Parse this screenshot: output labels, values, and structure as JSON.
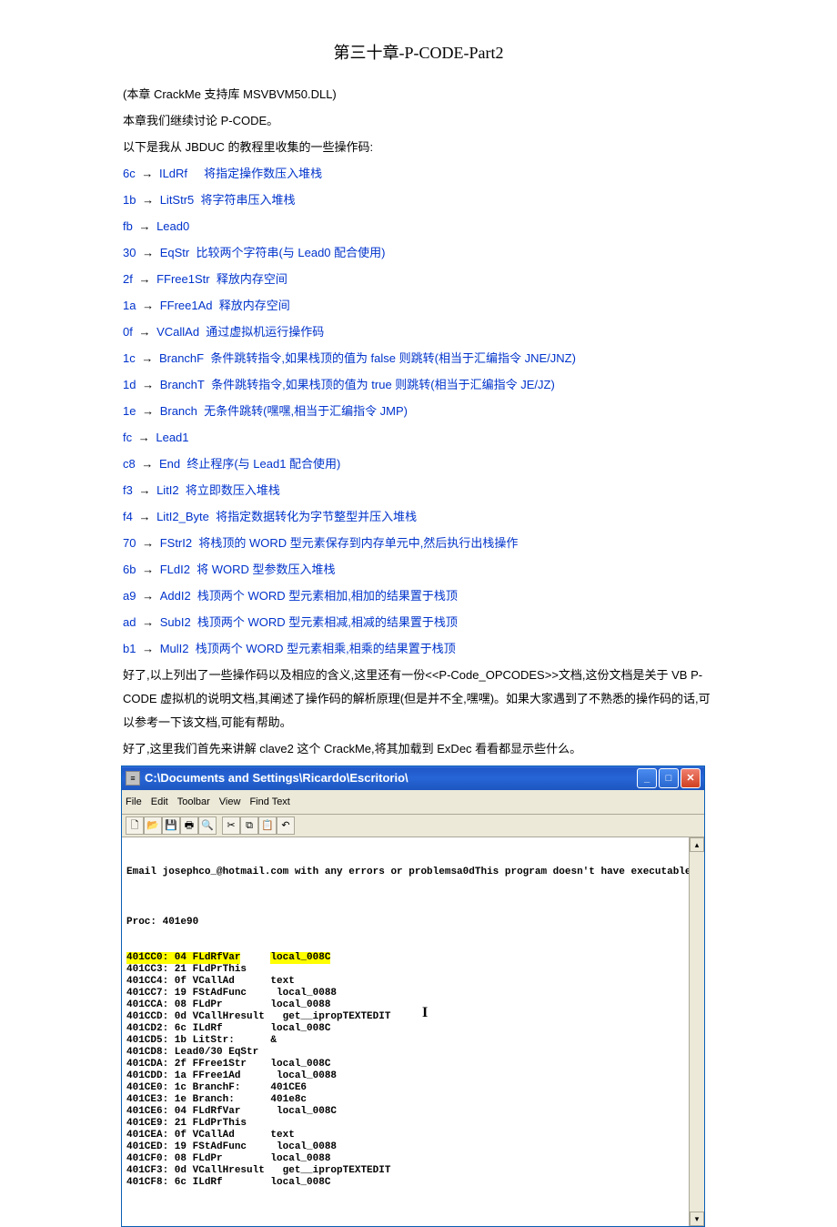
{
  "title": "第三十章-P-CODE-Part2",
  "intro1": "(本章 CrackMe 支持库 MSVBVM50.DLL)",
  "intro2": "本章我们继续讨论 P-CODE。",
  "intro3": "以下是我从 JBDUC 的教程里收集的一些操作码:",
  "opcodes": [
    {
      "hex": "6c",
      "name": "ILdRf",
      "desc": "将指定操作数压入堆栈",
      "spaced": true
    },
    {
      "hex": "1b",
      "name": "LitStr5",
      "desc": "将字符串压入堆栈"
    },
    {
      "hex": "fb",
      "name": "Lead0",
      "desc": ""
    },
    {
      "hex": "30",
      "name": "EqStr",
      "desc": "比较两个字符串(与 Lead0 配合使用)"
    },
    {
      "hex": "2f",
      "name": "FFree1Str",
      "desc": "释放内存空间"
    },
    {
      "hex": "1a",
      "name": "FFree1Ad",
      "desc": "释放内存空间"
    },
    {
      "hex": "0f",
      "name": "VCallAd",
      "desc": "通过虚拟机运行操作码"
    },
    {
      "hex": "1c",
      "name": "BranchF",
      "desc": "条件跳转指令,如果栈顶的值为 false 则跳转(相当于汇编指令 JNE/JNZ)"
    },
    {
      "hex": "1d",
      "name": "BranchT",
      "desc": "条件跳转指令,如果栈顶的值为 true 则跳转(相当于汇编指令 JE/JZ)"
    },
    {
      "hex": "1e",
      "name": "Branch",
      "desc": "无条件跳转(嘿嘿,相当于汇编指令 JMP)"
    },
    {
      "hex": "fc",
      "name": "Lead1",
      "desc": ""
    },
    {
      "hex": "c8",
      "name": "End",
      "desc": "终止程序(与 Lead1 配合使用)"
    },
    {
      "hex": "f3",
      "name": "LitI2",
      "desc": "将立即数压入堆栈"
    },
    {
      "hex": "f4",
      "name": "LitI2_Byte",
      "desc": "将指定数据转化为字节整型并压入堆栈"
    },
    {
      "hex": "70",
      "name": "FStrI2",
      "desc": "将栈顶的 WORD 型元素保存到内存单元中,然后执行出栈操作"
    },
    {
      "hex": "6b",
      "name": "FLdI2",
      "desc": "将 WORD 型参数压入堆栈"
    },
    {
      "hex": "a9",
      "name": "AddI2",
      "desc": "栈顶两个 WORD 型元素相加,相加的结果置于栈顶"
    },
    {
      "hex": "ad",
      "name": "SubI2",
      "desc": "栈顶两个 WORD 型元素相减,相减的结果置于栈顶"
    },
    {
      "hex": "b1",
      "name": "MulI2",
      "desc": "栈顶两个 WORD 型元素相乘,相乘的结果置于栈顶"
    }
  ],
  "outro1": "好了,以上列出了一些操作码以及相应的含义,这里还有一份<<P-Code_OPCODES>>文档,这份文档是关于 VB P-CODE 虚拟机的说明文档,其阐述了操作码的解析原理(但是并不全,嘿嘿)。如果大家遇到了不熟悉的操作码的话,可以参考一下该文档,可能有帮助。",
  "outro2": "好了,这里我们首先来讲解 clave2 这个 CrackMe,将其加载到 ExDec 看看都显示些什么。",
  "window": {
    "title": "C:\\Documents and Settings\\Ricardo\\Escritorio\\",
    "menu": [
      "File",
      "Edit",
      "Toolbar",
      "View",
      "Find Text"
    ],
    "msg": "Email josephco_@hotmail.com with any errors or problemsa0dThis program doesn't have executable code right a",
    "proc": "Proc: 401e90",
    "lines": [
      {
        "a": "401CC0: 04 FLdRfVar",
        "b": "local_008C",
        "hl": true
      },
      {
        "a": "401CC3: 21 FLdPrThis",
        "b": ""
      },
      {
        "a": "401CC4: 0f VCallAd",
        "b": "text"
      },
      {
        "a": "401CC7: 19 FStAdFunc",
        "b": " local_0088"
      },
      {
        "a": "401CCA: 08 FLdPr",
        "b": "local_0088"
      },
      {
        "a": "401CCD: 0d VCallHresult",
        "b": "  get__ipropTEXTEDIT"
      },
      {
        "a": "401CD2: 6c ILdRf",
        "b": "local_008C"
      },
      {
        "a": "401CD5: 1b LitStr:",
        "b": "&"
      },
      {
        "a": "401CD8: Lead0/30 EqStr",
        "b": ""
      },
      {
        "a": "401CDA: 2f FFree1Str",
        "b": "local_008C"
      },
      {
        "a": "401CDD: 1a FFree1Ad",
        "b": " local_0088"
      },
      {
        "a": "401CE0: 1c BranchF:",
        "b": "401CE6"
      },
      {
        "a": "401CE3: 1e Branch:",
        "b": "401e8c"
      },
      {
        "a": "401CE6: 04 FLdRfVar",
        "b": " local_008C"
      },
      {
        "a": "401CE9: 21 FLdPrThis",
        "b": ""
      },
      {
        "a": "401CEA: 0f VCallAd",
        "b": "text"
      },
      {
        "a": "401CED: 19 FStAdFunc",
        "b": " local_0088"
      },
      {
        "a": "401CF0: 08 FLdPr",
        "b": "local_0088"
      },
      {
        "a": "401CF3: 0d VCallHresult",
        "b": "  get__ipropTEXTEDIT"
      },
      {
        "a": "401CF8: 6c ILdRf",
        "b": "local_008C"
      }
    ]
  }
}
